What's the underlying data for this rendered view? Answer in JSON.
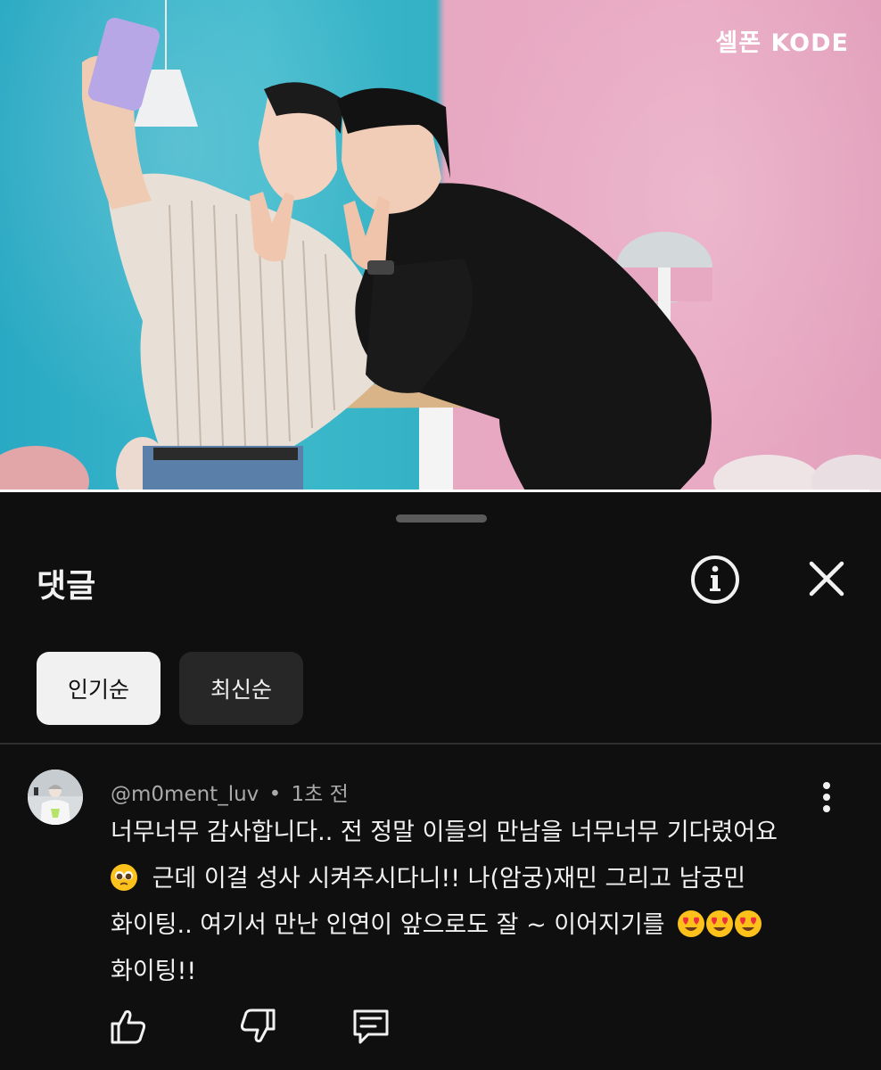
{
  "video": {
    "channel_logo": "셀폰 KODE",
    "progress": 0.987
  },
  "comments_sheet": {
    "title": "댓글",
    "info_icon": "info-icon",
    "close_icon": "close-icon",
    "sort_tabs": [
      {
        "label": "인기순",
        "selected": true
      },
      {
        "label": "최신순",
        "selected": false
      }
    ]
  },
  "comment": {
    "author": "@m0ment_luv",
    "separator": "•",
    "time": "1초 전",
    "lines": [
      "너무너무 감사합니다.. 전 정말 이들의 만남을 너무너무 기다렸어요",
      "근데 이걸 성사 시켜주시다니!! 나(암궁)재민 그리고 남궁민",
      "화이팅.. 여기서 만난 인연이 앞으로도 잘 ~ 이어지기를",
      "화이팅!!"
    ],
    "emojis": [
      "pleading-face",
      "smiling-face-with-heart-eyes"
    ],
    "actions": [
      "thumbs-up-icon",
      "thumbs-down-icon",
      "reply-icon"
    ]
  },
  "colors": {
    "background": "#0f0f0f",
    "chip_selected": "#f1f1f1",
    "chip_unselected": "#272727",
    "secondary_text": "#aaaaaa"
  }
}
